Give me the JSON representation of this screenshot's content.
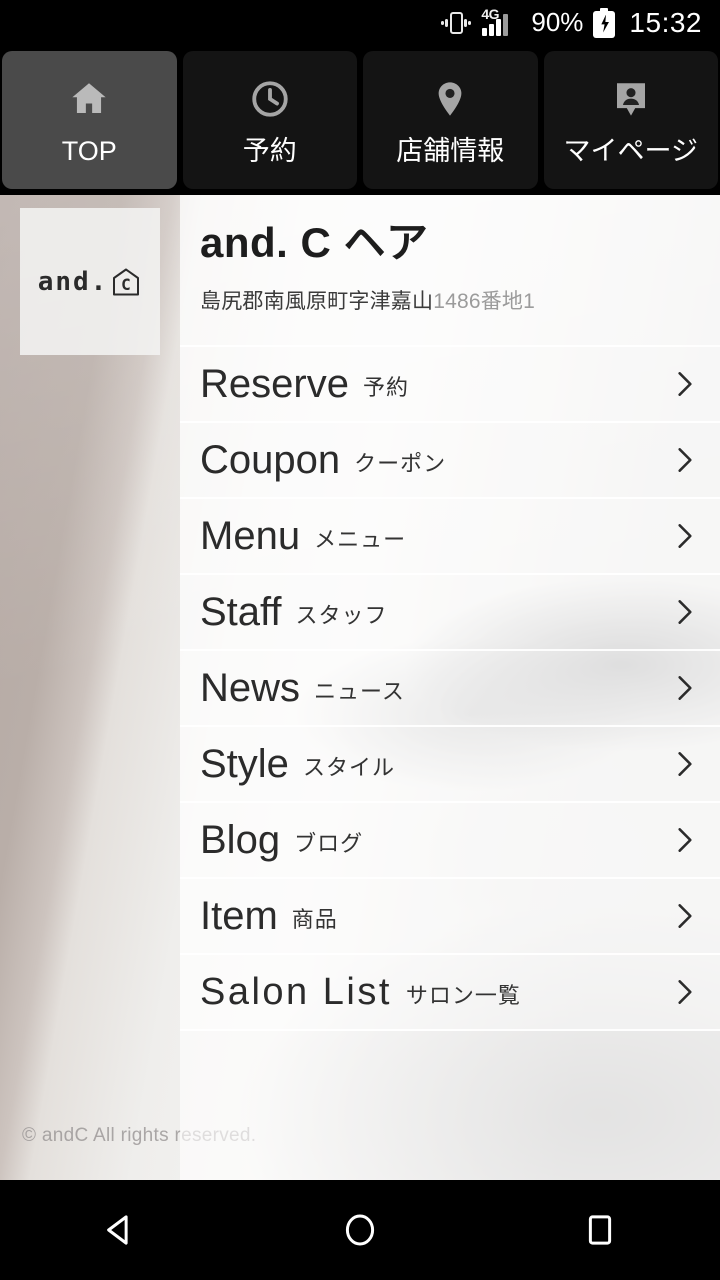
{
  "statusbar": {
    "network": "4G",
    "battery_percent": "90%",
    "time": "15:32",
    "vibrate_icon": "vibrate-icon",
    "signal_icon": "signal-bars-icon",
    "battery_icon": "battery-charging-icon"
  },
  "tabs": [
    {
      "label": "TOP",
      "icon": "home-icon",
      "active": true
    },
    {
      "label": "予約",
      "icon": "clock-icon",
      "active": false
    },
    {
      "label": "店舗情報",
      "icon": "map-pin-icon",
      "active": false
    },
    {
      "label": "マイページ",
      "icon": "person-badge-icon",
      "active": false
    }
  ],
  "logo": {
    "text": "and.",
    "mark_letter": "C",
    "mark_icon": "house-outline-icon"
  },
  "salon": {
    "title": "and. C ヘア",
    "address_main": "島尻郡南風原町字津嘉山",
    "address_number": "1486番地1"
  },
  "menu": [
    {
      "en": "Reserve",
      "ja": "予約",
      "chevron": "chevron-right-icon",
      "wide": false
    },
    {
      "en": "Coupon",
      "ja": "クーポン",
      "chevron": "chevron-right-icon",
      "wide": false
    },
    {
      "en": "Menu",
      "ja": "メニュー",
      "chevron": "chevron-right-icon",
      "wide": false
    },
    {
      "en": "Staff",
      "ja": "スタッフ",
      "chevron": "chevron-right-icon",
      "wide": false
    },
    {
      "en": "News",
      "ja": "ニュース",
      "chevron": "chevron-right-icon",
      "wide": false
    },
    {
      "en": "Style",
      "ja": "スタイル",
      "chevron": "chevron-right-icon",
      "wide": false
    },
    {
      "en": "Blog",
      "ja": "ブログ",
      "chevron": "chevron-right-icon",
      "wide": false
    },
    {
      "en": "Item",
      "ja": "商品",
      "chevron": "chevron-right-icon",
      "wide": false
    },
    {
      "en": "Salon List",
      "ja": "サロン一覧",
      "chevron": "chevron-right-icon",
      "wide": true
    }
  ],
  "footer": {
    "copyright": "© andC All rights reserved."
  },
  "navbar": {
    "back": "back-triangle-icon",
    "home": "home-circle-icon",
    "recents": "recents-square-icon"
  },
  "colors": {
    "tab_active_bg": "#4a4a4a",
    "tab_bg": "#141414",
    "system_bar_bg": "#000000",
    "panel_overlay": "rgba(255,255,255,0.62)",
    "title_text": "#1d1d1d",
    "menu_text": "#2b2b2b",
    "muted_text": "#9b9b9b"
  }
}
